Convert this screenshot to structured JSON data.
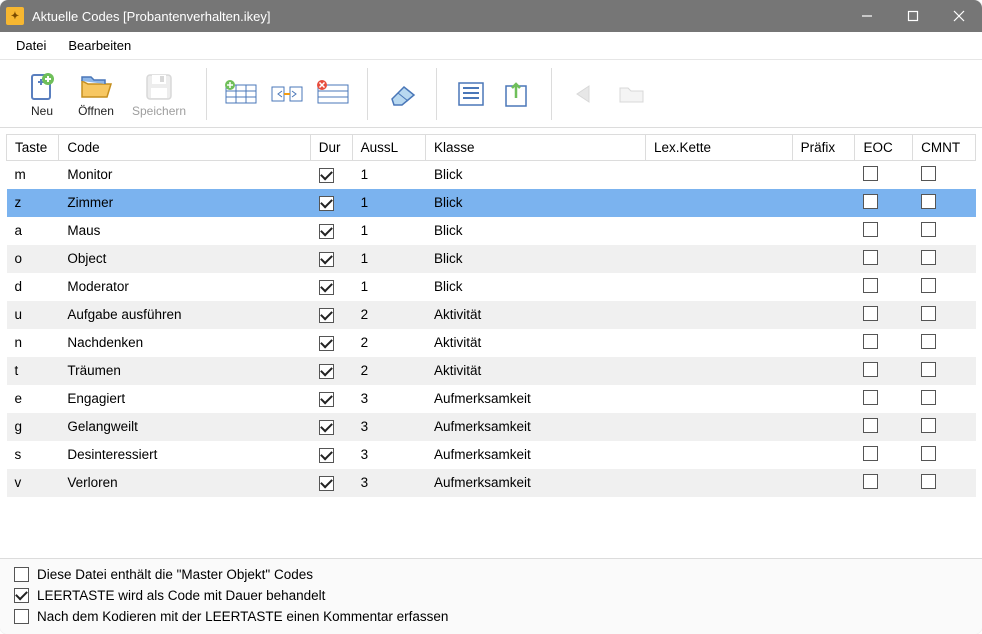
{
  "window": {
    "title": "Aktuelle Codes [Probantenverhalten.ikey]"
  },
  "menu": {
    "file": "Datei",
    "edit": "Bearbeiten"
  },
  "toolbar": {
    "new": "Neu",
    "open": "Öffnen",
    "save": "Speichern"
  },
  "columns": {
    "taste": "Taste",
    "code": "Code",
    "dur": "Dur",
    "aussl": "AussL",
    "klasse": "Klasse",
    "lex": "Lex.Kette",
    "prafix": "Präfix",
    "eoc": "EOC",
    "cmnt": "CMNT"
  },
  "rows": [
    {
      "taste": "m",
      "code": "Monitor",
      "dur": true,
      "aussl": "1",
      "klasse": "Blick",
      "lex": "",
      "prafix": "",
      "eoc": false,
      "cmnt": false,
      "selected": false
    },
    {
      "taste": "z",
      "code": "Zimmer",
      "dur": true,
      "aussl": "1",
      "klasse": "Blick",
      "lex": "",
      "prafix": "",
      "eoc": false,
      "cmnt": false,
      "selected": true
    },
    {
      "taste": "a",
      "code": "Maus",
      "dur": true,
      "aussl": "1",
      "klasse": "Blick",
      "lex": "",
      "prafix": "",
      "eoc": false,
      "cmnt": false,
      "selected": false
    },
    {
      "taste": "o",
      "code": "Object",
      "dur": true,
      "aussl": "1",
      "klasse": "Blick",
      "lex": "",
      "prafix": "",
      "eoc": false,
      "cmnt": false,
      "selected": false
    },
    {
      "taste": "d",
      "code": "Moderator",
      "dur": true,
      "aussl": "1",
      "klasse": "Blick",
      "lex": "",
      "prafix": "",
      "eoc": false,
      "cmnt": false,
      "selected": false
    },
    {
      "taste": "u",
      "code": "Aufgabe ausführen",
      "dur": true,
      "aussl": "2",
      "klasse": "Aktivität",
      "lex": "",
      "prafix": "",
      "eoc": false,
      "cmnt": false,
      "selected": false
    },
    {
      "taste": "n",
      "code": "Nachdenken",
      "dur": true,
      "aussl": "2",
      "klasse": "Aktivität",
      "lex": "",
      "prafix": "",
      "eoc": false,
      "cmnt": false,
      "selected": false
    },
    {
      "taste": "t",
      "code": "Träumen",
      "dur": true,
      "aussl": "2",
      "klasse": "Aktivität",
      "lex": "",
      "prafix": "",
      "eoc": false,
      "cmnt": false,
      "selected": false
    },
    {
      "taste": "e",
      "code": "Engagiert",
      "dur": true,
      "aussl": "3",
      "klasse": "Aufmerksamkeit",
      "lex": "",
      "prafix": "",
      "eoc": false,
      "cmnt": false,
      "selected": false
    },
    {
      "taste": "g",
      "code": "Gelangweilt",
      "dur": true,
      "aussl": "3",
      "klasse": "Aufmerksamkeit",
      "lex": "",
      "prafix": "",
      "eoc": false,
      "cmnt": false,
      "selected": false
    },
    {
      "taste": "s",
      "code": "Desinteressiert",
      "dur": true,
      "aussl": "3",
      "klasse": "Aufmerksamkeit",
      "lex": "",
      "prafix": "",
      "eoc": false,
      "cmnt": false,
      "selected": false
    },
    {
      "taste": "v",
      "code": "Verloren",
      "dur": true,
      "aussl": "3",
      "klasse": "Aufmerksamkeit",
      "lex": "",
      "prafix": "",
      "eoc": false,
      "cmnt": false,
      "selected": false
    }
  ],
  "options": {
    "master": {
      "checked": false,
      "label": "Diese Datei enthält die \"Master Objekt\" Codes"
    },
    "space": {
      "checked": true,
      "label": "LEERTASTE wird als Code mit Dauer behandelt"
    },
    "comment": {
      "checked": false,
      "label": "Nach dem Kodieren mit der LEERTASTE einen Kommentar erfassen"
    }
  }
}
